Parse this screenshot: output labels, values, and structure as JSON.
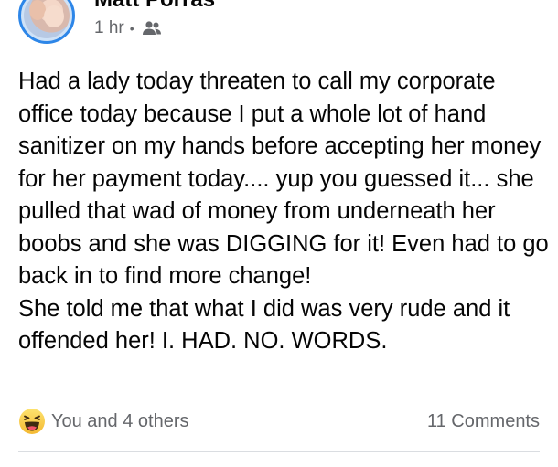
{
  "post": {
    "author": "Matt Porras",
    "timestamp": "1 hr",
    "separator": "•",
    "audience_icon": "friends-icon",
    "paragraphs": [
      "Had a lady today threaten to call my corporate office today because I put a whole lot of hand sanitizer on my hands before accepting her money for her payment today.... yup you guessed it... she pulled that wad of money from underneath her boobs and she was DIGGING for it! Even had to go back in to find more change!",
      "She told me that what I did was very rude and it offended her! I. HAD. NO. WORDS."
    ]
  },
  "footer": {
    "reaction_icon": "haha-icon",
    "reactions_text": "You and 4 others",
    "comments_text": "11 Comments"
  },
  "colors": {
    "avatar_ring": "#2d86e8",
    "secondary_text": "#65676b",
    "primary_text": "#050505",
    "haha_yellow": "#f7c33c"
  }
}
